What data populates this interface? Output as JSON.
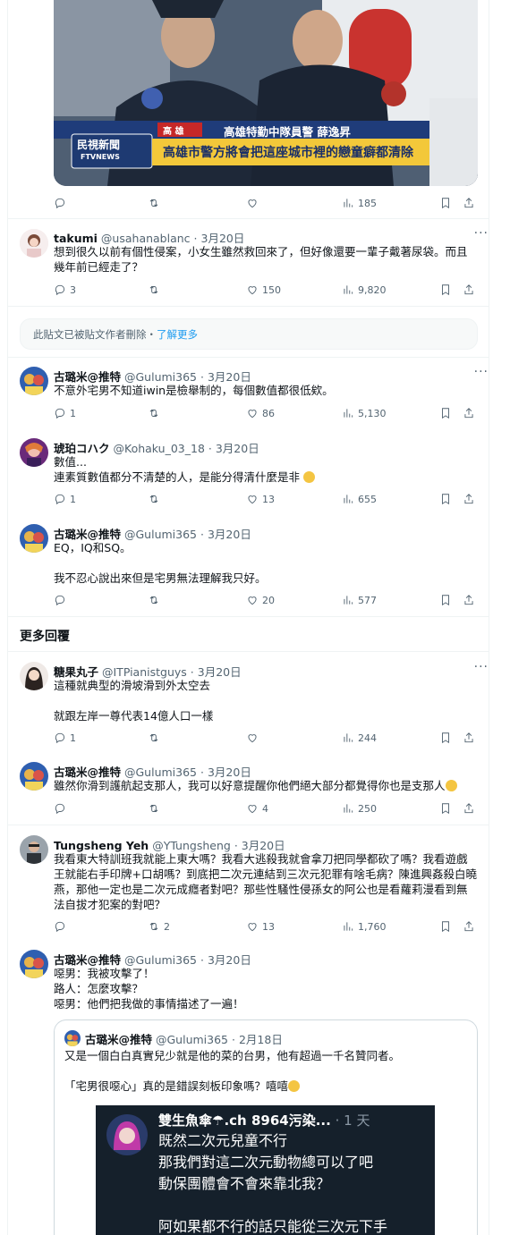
{
  "media": {
    "caption_name": "高雄特勤中隊員警 薛逸昇",
    "caption_location": "高 雄",
    "caption_headline": "高雄市警方將會把這座城市裡的戀童癖都清除",
    "news_logo_top": "民視新聞",
    "news_logo_bottom": "FTVNEWS"
  },
  "top_actions": {
    "views": "185"
  },
  "deleted_notice": {
    "text": "此貼文已被貼文作者刪除・",
    "link": "了解更多"
  },
  "more_replies_label": "更多回覆",
  "tweets": [
    {
      "name": "takumi",
      "handle": "@usahanablanc",
      "date": "3月20日",
      "lines": [
        "想到很久以前有個性侵案，小女生雖然救回來了，但好像還要一輩子戴著尿袋。而且",
        "幾年前已經走了？"
      ],
      "replies": "3",
      "retweets": "",
      "likes": "150",
      "views": "9,820"
    },
    {
      "name": "古璐米@推特",
      "handle": "@Gulumi365",
      "date": "3月20日",
      "lines": [
        "不意外宅男不知道iwin是檢舉制的，每個數值都很低欸。"
      ],
      "replies": "1",
      "retweets": "",
      "likes": "86",
      "views": "5,130"
    },
    {
      "name": "琥珀コハク",
      "handle": "@Kohaku_03_18",
      "date": "3月20日",
      "lines": [
        "數值...",
        "連素質數值都分不清楚的人，是能分得清什麼是非"
      ],
      "replies": "1",
      "retweets": "",
      "likes": "13",
      "views": "655"
    },
    {
      "name": "古璐米@推特",
      "handle": "@Gulumi365",
      "date": "3月20日",
      "lines": [
        "EQ，IQ和SQ。",
        "",
        "我不忍心說出來但是宅男無法理解我只好。"
      ],
      "replies": "",
      "retweets": "",
      "likes": "20",
      "views": "577"
    },
    {
      "name": "糖果丸子",
      "handle": "@ITPianistguys",
      "date": "3月20日",
      "lines": [
        "這種就典型的滑坡滑到外太空去",
        "",
        "就跟左岸一尊代表14億人口一樣"
      ],
      "replies": "1",
      "retweets": "",
      "likes": "",
      "views": "244"
    },
    {
      "name": "古璐米@推特",
      "handle": "@Gulumi365",
      "date": "3月20日",
      "lines": [
        "雖然你滑到護航起支那人，我可以好意提醒你他們絕大部分都覺得你也是支那人"
      ],
      "replies": "",
      "retweets": "",
      "likes": "4",
      "views": "250"
    },
    {
      "name": "Tungsheng Yeh",
      "handle": "@YTungsheng",
      "date": "3月20日",
      "lines": [
        "我看東大特訓班我就能上東大嗎？我看大逃殺我就會拿刀把同學都砍了嗎？我看遊戲",
        "王就能右手印牌+口胡嗎？到底把二次元連結到三次元犯罪有啥毛病？陳進興姦殺白曉",
        "燕，那他一定也是二次元成癮者對吧？那些性騷性侵孫女的阿公也是看蘿莉漫看到無",
        "法自拔才犯案的對吧？"
      ],
      "replies": "",
      "retweets": "2",
      "likes": "13",
      "views": "1,760"
    },
    {
      "name": "古璐米@推特",
      "handle": "@Gulumi365",
      "date": "3月20日",
      "lines": [
        "噁男：我被攻擊了！",
        "路人：怎麼攻擊？",
        "噁男：他們把我做的事情描述了一遍！"
      ]
    }
  ],
  "quote": {
    "name": "古璐米@推特",
    "handle": "@Gulumi365",
    "date": "2月18日",
    "lines": [
      "又是一個白白真實兒少就是他的菜的台男，他有超過一千名贊同者。",
      "",
      "「宅男很噁心」真的是錯誤刻板印象嗎？嘻嘻"
    ]
  },
  "inner_screenshot": {
    "name": "雙生魚傘",
    "name_suffix": ".ch 8964污染...",
    "time": "1 天",
    "lines": [
      "既然二次元兒童不行",
      "那我們對這二次元動物總可以了吧",
      "動保團體會不會來靠北我？",
      "",
      "阿如果都不行的話只能從三次元下手"
    ]
  },
  "colors": {
    "link": "#1d9bf0",
    "muted": "#536471",
    "text": "#0f1419",
    "border": "#eff3f4"
  }
}
